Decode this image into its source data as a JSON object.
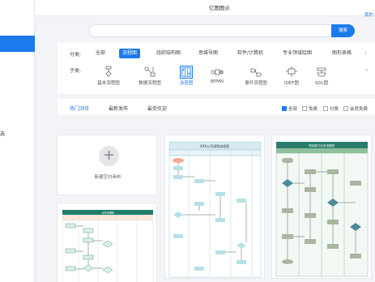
{
  "app": {
    "title": "亿图图示",
    "top_link": "我的"
  },
  "sidebar": {
    "item_text": "选"
  },
  "search": {
    "placeholder": "",
    "button": "搜索"
  },
  "filters": {
    "category_label": "分类:",
    "categories": [
      "全部",
      "流程图",
      "组织结构图",
      "思维导图",
      "软件/计算机",
      "专业领域绘图",
      "图形表格"
    ],
    "subtype_label": "子类:",
    "subtypes": [
      "基本流程图",
      "数据流程图",
      "泳道图",
      "BPMN",
      "事件流程图",
      "IDEF图",
      "SDL图"
    ]
  },
  "tabs": [
    "热门浏览",
    "最新发布",
    "最受欢迎"
  ],
  "price_filters": [
    "全部",
    "免费",
    "付费",
    "会员免费"
  ],
  "new_card_label": "新建空白画布",
  "thumb2": {
    "title": "XXX公司采购流程图"
  },
  "thumb3": {
    "title": "物流部门业务流程图"
  },
  "thumb4": {
    "title": "业务流程图"
  },
  "colors": {
    "accent": "#1c7aef",
    "green_header": "#8fbf9c",
    "teal_header": "#2a7d6c",
    "swim_bg": "#e3f1f5"
  }
}
